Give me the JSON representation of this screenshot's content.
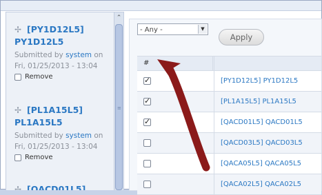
{
  "left": {
    "items": [
      {
        "title": "[PY1D12L5]\nPY1D12L5",
        "submitted_prefix": "Submitted by",
        "author": "system",
        "submitted_suffix": "on",
        "date": "Fri, 01/25/2013 - 13:04",
        "remove_label": "Remove"
      },
      {
        "title": "[PL1A15L5]\nPL1A15L5",
        "submitted_prefix": "Submitted by",
        "author": "system",
        "submitted_suffix": "on",
        "date": "Fri, 01/25/2013 - 13:04",
        "remove_label": "Remove"
      },
      {
        "title": "[QACD01L5]"
      }
    ]
  },
  "right": {
    "filter": {
      "value": "- Any -"
    },
    "apply_label": "Apply",
    "table": {
      "header": "#",
      "rows": [
        {
          "checked": true,
          "label": "[PY1D12L5] PY1D12L5"
        },
        {
          "checked": true,
          "label": "[PL1A15L5] PL1A15L5"
        },
        {
          "checked": true,
          "label": "[QACD01L5] QACD01L5"
        },
        {
          "checked": false,
          "label": "[QACD03L5] QACD03L5"
        },
        {
          "checked": false,
          "label": "[QACA05L5] QACA05L5"
        },
        {
          "checked": false,
          "label": "[QACA02L5] QACA02L5"
        }
      ]
    }
  },
  "annotation": {
    "arrow_color": "#8b1a1a"
  }
}
